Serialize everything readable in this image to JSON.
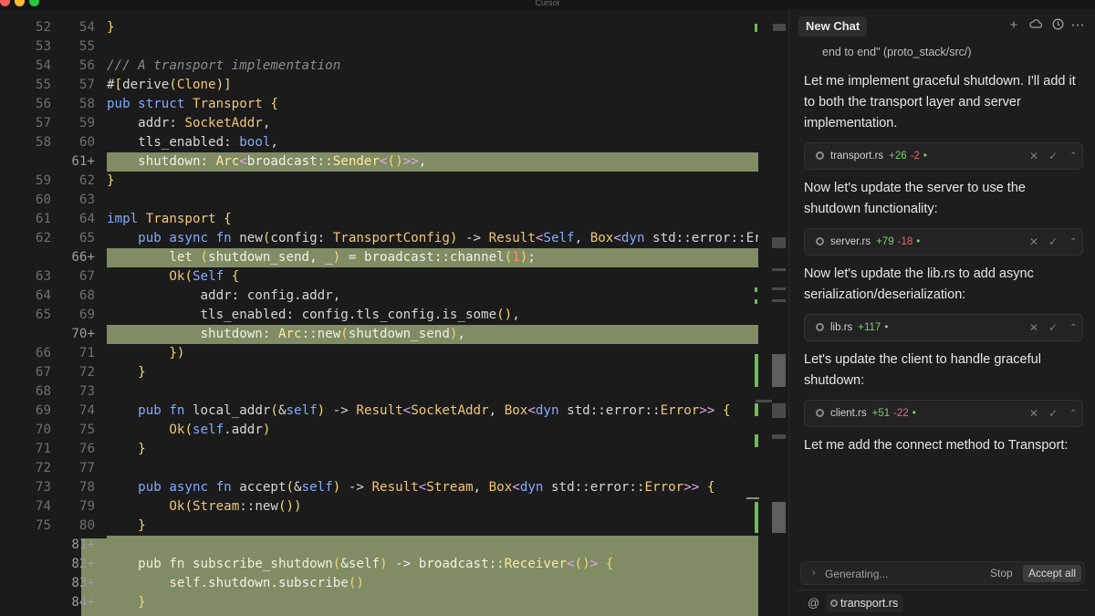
{
  "window": {
    "title": "Cursor"
  },
  "editor": {
    "lines": [
      {
        "old": "52",
        "new": "54",
        "added": false,
        "code": "}"
      },
      {
        "old": "53",
        "new": "55",
        "added": false,
        "code": ""
      },
      {
        "old": "54",
        "new": "56",
        "added": false,
        "code": "/// A transport implementation"
      },
      {
        "old": "55",
        "new": "57",
        "added": false,
        "code": "#[derive(Clone)]"
      },
      {
        "old": "56",
        "new": "58",
        "added": false,
        "code": "pub struct Transport {"
      },
      {
        "old": "57",
        "new": "59",
        "added": false,
        "code": "    addr: SocketAddr,"
      },
      {
        "old": "58",
        "new": "60",
        "added": false,
        "code": "    tls_enabled: bool,"
      },
      {
        "old": "",
        "new": "61+",
        "added": true,
        "code": "    shutdown: Arc<broadcast::Sender<()>>,"
      },
      {
        "old": "59",
        "new": "62",
        "added": false,
        "code": "}"
      },
      {
        "old": "60",
        "new": "63",
        "added": false,
        "code": ""
      },
      {
        "old": "61",
        "new": "64",
        "added": false,
        "code": "impl Transport {"
      },
      {
        "old": "62",
        "new": "65",
        "added": false,
        "code": "    pub async fn new(config: TransportConfig) -> Result<Self, Box<dyn std::error::Er"
      },
      {
        "old": "",
        "new": "66+",
        "added": true,
        "code": "        let (shutdown_send, _) = broadcast::channel(1);"
      },
      {
        "old": "63",
        "new": "67",
        "added": false,
        "code": "        Ok(Self {"
      },
      {
        "old": "64",
        "new": "68",
        "added": false,
        "code": "            addr: config.addr,"
      },
      {
        "old": "65",
        "new": "69",
        "added": false,
        "code": "            tls_enabled: config.tls_config.is_some(),"
      },
      {
        "old": "",
        "new": "70+",
        "added": true,
        "code": "            shutdown: Arc::new(shutdown_send),"
      },
      {
        "old": "66",
        "new": "71",
        "added": false,
        "code": "        })"
      },
      {
        "old": "67",
        "new": "72",
        "added": false,
        "code": "    }"
      },
      {
        "old": "68",
        "new": "73",
        "added": false,
        "code": ""
      },
      {
        "old": "69",
        "new": "74",
        "added": false,
        "code": "    pub fn local_addr(&self) -> Result<SocketAddr, Box<dyn std::error::Error>> {"
      },
      {
        "old": "70",
        "new": "75",
        "added": false,
        "code": "        Ok(self.addr)"
      },
      {
        "old": "71",
        "new": "76",
        "added": false,
        "code": "    }"
      },
      {
        "old": "72",
        "new": "77",
        "added": false,
        "code": ""
      },
      {
        "old": "73",
        "new": "78",
        "added": false,
        "code": "    pub async fn accept(&self) -> Result<Stream, Box<dyn std::error::Error>> {"
      },
      {
        "old": "74",
        "new": "79",
        "added": false,
        "code": "        Ok(Stream::new())"
      },
      {
        "old": "75",
        "new": "80",
        "added": false,
        "code": "    }"
      },
      {
        "old": "",
        "new": "81+",
        "added": true,
        "code": ""
      },
      {
        "old": "",
        "new": "82+",
        "added": true,
        "code": "    pub fn subscribe_shutdown(&self) -> broadcast::Receiver<()> {"
      },
      {
        "old": "",
        "new": "83+",
        "added": true,
        "code": "        self.shutdown.subscribe()"
      },
      {
        "old": "",
        "new": "84+",
        "added": true,
        "code": "    }"
      }
    ]
  },
  "chat": {
    "tab_label": "New Chat",
    "header_icons": [
      "plus-icon",
      "cloud-icon",
      "history-icon",
      "more-icon"
    ],
    "context_line": "end to end\" (proto_stack/src/)",
    "messages": [
      {
        "text": "Let me implement graceful shutdown. I'll add it to both the transport layer and server implementation."
      },
      {
        "text": "Now let's update the server to use the shutdown functionality:"
      },
      {
        "text": "Now let's update the lib.rs to add async serialization/deserialization:"
      },
      {
        "text": "Let's update the client to handle graceful shutdown:"
      },
      {
        "text": "Let me add the connect method to Transport:"
      }
    ],
    "file_chips": [
      {
        "name": "transport.rs",
        "added": "+26",
        "removed": "-2"
      },
      {
        "name": "server.rs",
        "added": "+79",
        "removed": "-18"
      },
      {
        "name": "lib.rs",
        "added": "+117",
        "removed": ""
      },
      {
        "name": "client.rs",
        "added": "+51",
        "removed": "-22"
      }
    ],
    "status": {
      "generating": "Generating...",
      "stop_label": "Stop",
      "accept_all_label": "Accept all"
    },
    "input": {
      "at_symbol": "@",
      "context_file": "transport.rs"
    }
  },
  "colors": {
    "added_line_bg": "#7f8c64",
    "diff_add": "#7fcf6b",
    "diff_remove": "#e06c6c",
    "keyword": "#82aaff",
    "type": "#f0c674"
  }
}
